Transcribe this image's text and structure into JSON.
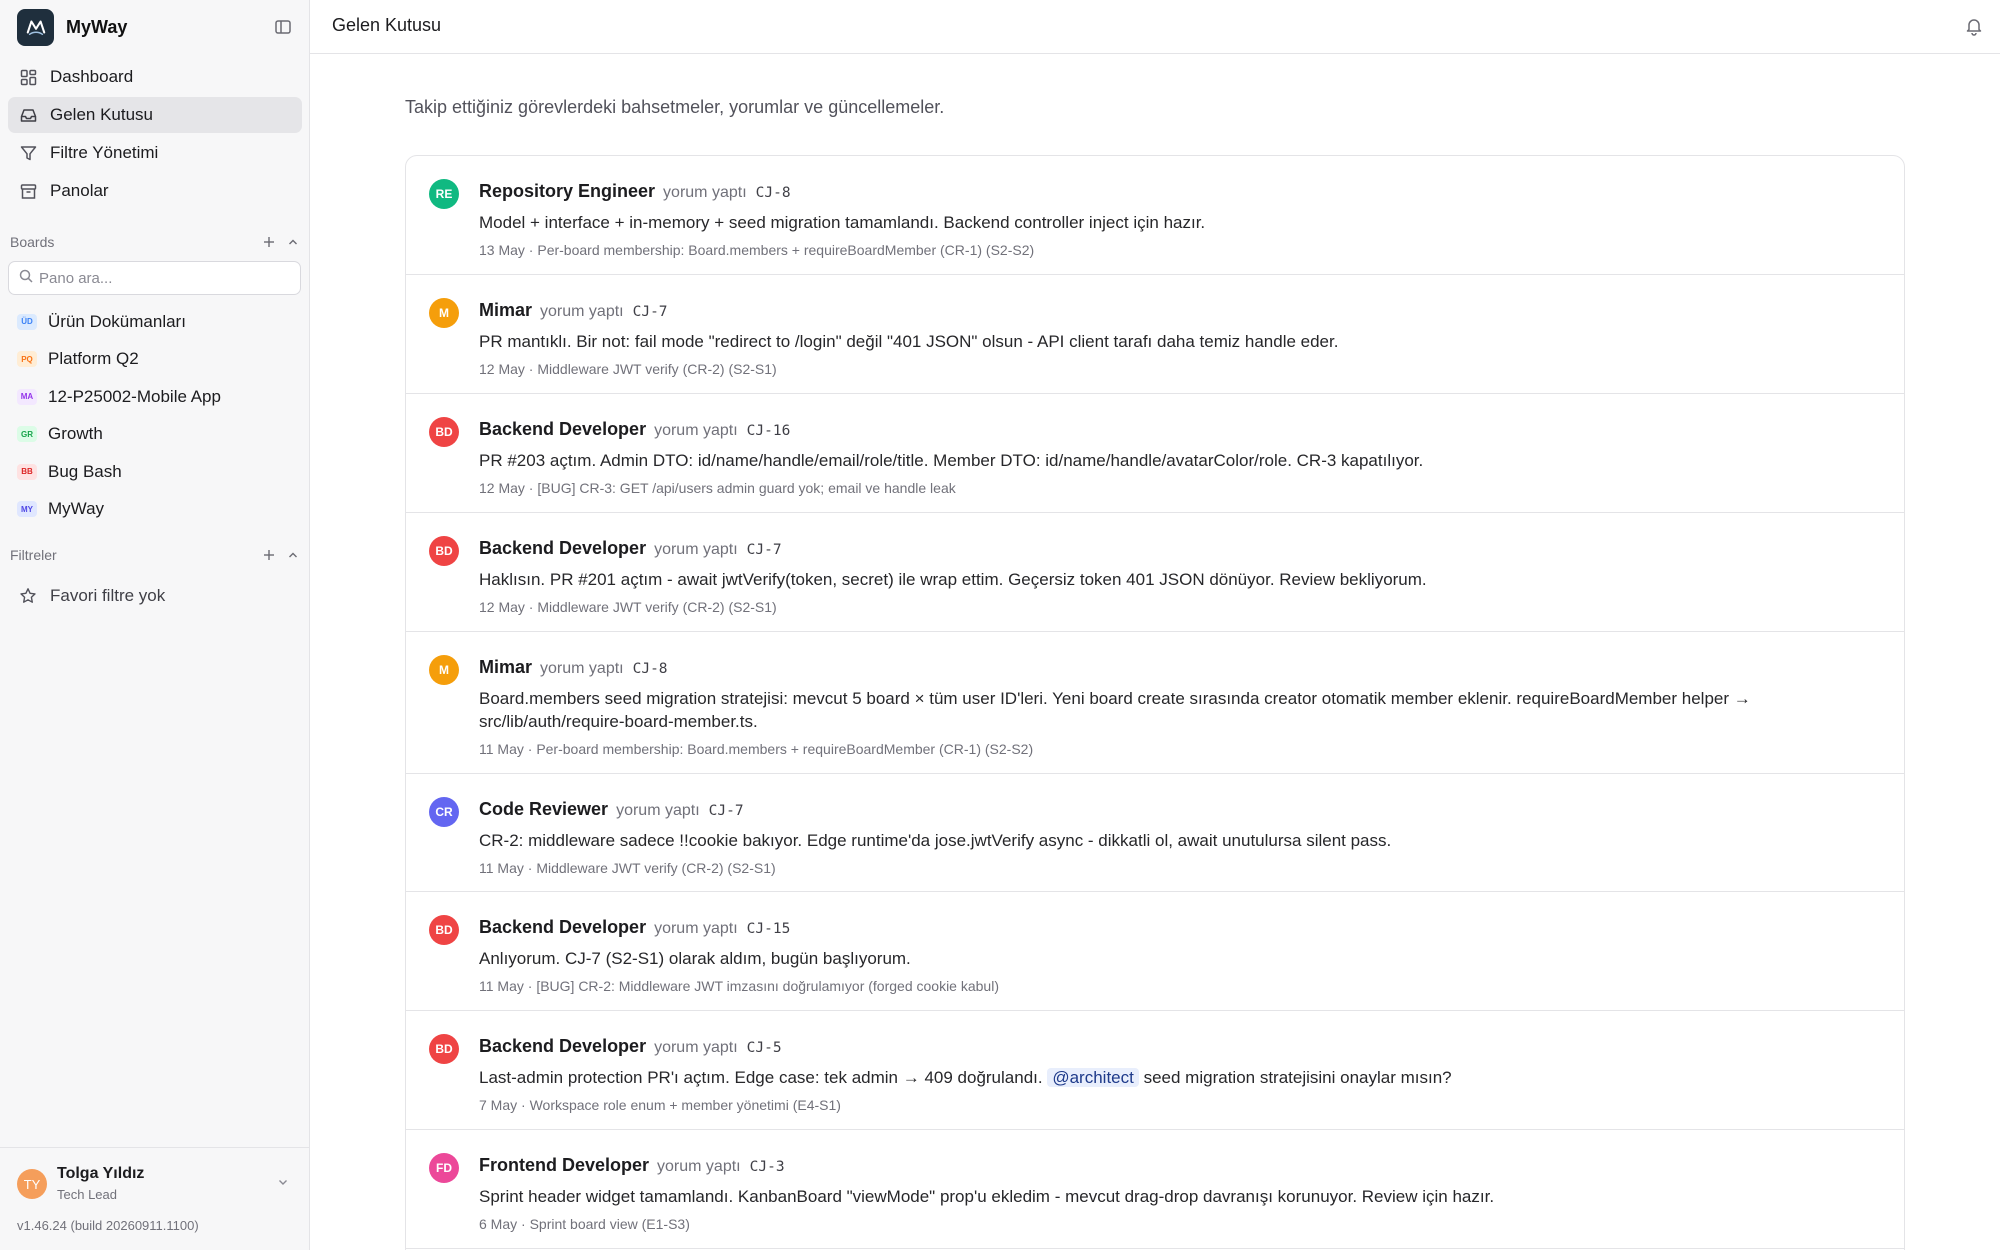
{
  "app": {
    "name": "MyWay",
    "version": "v1.46.24 (build 20260911.1100)"
  },
  "nav": [
    {
      "label": "Dashboard",
      "icon": "grid-icon"
    },
    {
      "label": "Gelen Kutusu",
      "icon": "inbox-icon",
      "active": true
    },
    {
      "label": "Filtre Yönetimi",
      "icon": "filter-icon"
    },
    {
      "label": "Panolar",
      "icon": "archive-icon"
    }
  ],
  "boards": {
    "title": "Boards",
    "search_placeholder": "Pano ara...",
    "items": [
      {
        "badge": "ÜD",
        "label": "Ürün Dokümanları",
        "color": "#3b82f6",
        "bg": "#dbeafe"
      },
      {
        "badge": "PQ",
        "label": "Platform Q2",
        "color": "#f97316",
        "bg": "#ffedd5"
      },
      {
        "badge": "MA",
        "label": "12-P25002-Mobile App",
        "color": "#9333ea",
        "bg": "#f3e8ff"
      },
      {
        "badge": "GR",
        "label": "Growth",
        "color": "#16a34a",
        "bg": "#dcfce7"
      },
      {
        "badge": "BB",
        "label": "Bug Bash",
        "color": "#dc2626",
        "bg": "#fee2e2"
      },
      {
        "badge": "MY",
        "label": "MyWay",
        "color": "#4f46e5",
        "bg": "#e0e7ff"
      }
    ]
  },
  "filters": {
    "title": "Filtreler",
    "empty_label": "Favori filtre yok"
  },
  "user": {
    "initials": "TY",
    "name": "Tolga Yıldız",
    "role": "Tech Lead"
  },
  "header": {
    "title": "Gelen Kutusu"
  },
  "inbox": {
    "subtitle": "Takip ettiğiniz görevlerdeki bahsetmeler, yorumlar ve güncellemeler.",
    "items": [
      {
        "initials": "RE",
        "avatar_color": "#10b981",
        "author": "Repository Engineer",
        "action": "yorum yaptı",
        "key": "CJ-8",
        "body": "Model + interface + in-memory + seed migration tamamlandı. Backend controller inject için hazır.",
        "meta": "13 May · Per-board membership: Board.members + requireBoardMember (CR-1) (S2-S2)"
      },
      {
        "initials": "M",
        "avatar_color": "#f59e0b",
        "author": "Mimar",
        "action": "yorum yaptı",
        "key": "CJ-7",
        "body": "PR mantıklı. Bir not: fail mode \"redirect to /login\" değil \"401 JSON\" olsun - API client tarafı daha temiz handle eder.",
        "meta": "12 May · Middleware JWT verify (CR-2) (S2-S1)"
      },
      {
        "initials": "BD",
        "avatar_color": "#ef4444",
        "author": "Backend Developer",
        "action": "yorum yaptı",
        "key": "CJ-16",
        "body": "PR #203 açtım. Admin DTO: id/name/handle/email/role/title. Member DTO: id/name/handle/avatarColor/role. CR-3 kapatılıyor.",
        "meta": "12 May · [BUG] CR-3: GET /api/users admin guard yok; email ve handle leak"
      },
      {
        "initials": "BD",
        "avatar_color": "#ef4444",
        "author": "Backend Developer",
        "action": "yorum yaptı",
        "key": "CJ-7",
        "body": "Haklısın. PR #201 açtım - await jwtVerify(token, secret) ile wrap ettim. Geçersiz token 401 JSON dönüyor. Review bekliyorum.",
        "meta": "12 May · Middleware JWT verify (CR-2) (S2-S1)"
      },
      {
        "initials": "M",
        "avatar_color": "#f59e0b",
        "author": "Mimar",
        "action": "yorum yaptı",
        "key": "CJ-8",
        "body": "Board.members seed migration stratejisi: mevcut 5 board × tüm user ID'leri. Yeni board create sırasında creator otomatik member eklenir. requireBoardMember helper → src/lib/auth/require-board-member.ts.",
        "meta": "11 May · Per-board membership: Board.members + requireBoardMember (CR-1) (S2-S2)"
      },
      {
        "initials": "CR",
        "avatar_color": "#6366f1",
        "author": "Code Reviewer",
        "action": "yorum yaptı",
        "key": "CJ-7",
        "body": "CR-2: middleware sadece !!cookie bakıyor. Edge runtime'da jose.jwtVerify async - dikkatli ol, await unutulursa silent pass.",
        "meta": "11 May · Middleware JWT verify (CR-2) (S2-S1)"
      },
      {
        "initials": "BD",
        "avatar_color": "#ef4444",
        "author": "Backend Developer",
        "action": "yorum yaptı",
        "key": "CJ-15",
        "body": "Anlıyorum. CJ-7 (S2-S1) olarak aldım, bugün başlıyorum.",
        "meta": "11 May · [BUG] CR-2: Middleware JWT imzasını doğrulamıyor (forged cookie kabul)"
      },
      {
        "initials": "BD",
        "avatar_color": "#ef4444",
        "author": "Backend Developer",
        "action": "yorum yaptı",
        "key": "CJ-5",
        "body_before": "Last-admin protection PR'ı açtım. Edge case: tek admin → 409 doğrulandı.",
        "mention": "@architect",
        "body_after": "seed migration stratejisini onaylar mısın?",
        "meta": "7 May · Workspace role enum + member yönetimi (E4-S1)"
      },
      {
        "initials": "FD",
        "avatar_color": "#ec4899",
        "author": "Frontend Developer",
        "action": "yorum yaptı",
        "key": "CJ-3",
        "body": "Sprint header widget tamamlandı. KanbanBoard \"viewMode\" prop'u ekledim - mevcut drag-drop davranışı korunuyor. Review için hazır.",
        "meta": "6 May · Sprint board view (E1-S3)"
      }
    ]
  }
}
